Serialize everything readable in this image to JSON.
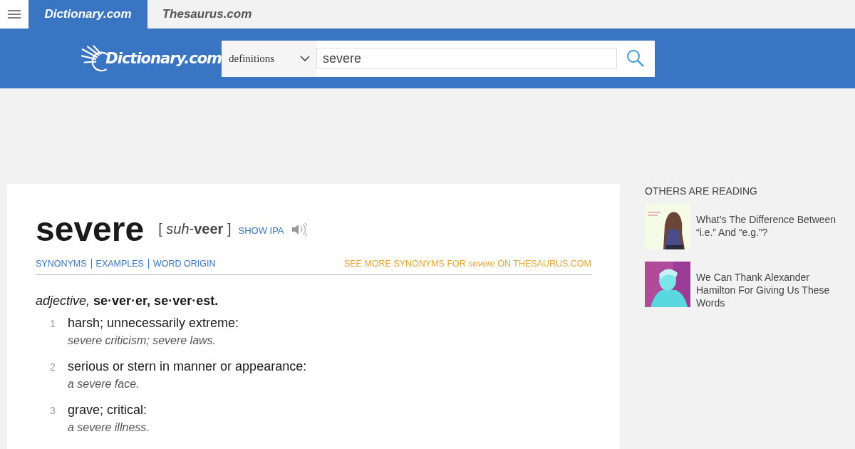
{
  "site_tabs": [
    {
      "label": "Dictionary.com",
      "selected": true
    },
    {
      "label": "Thesaurus.com",
      "selected": false
    }
  ],
  "header": {
    "logo": "Dictionary.com",
    "search_type": "definitions",
    "search_value": "severe"
  },
  "entry": {
    "word": "severe",
    "pronunciation": "[ *suh*-**veer** ]",
    "show_ipa": "SHOW IPA",
    "links": [
      "SYNONYMS",
      "EXAMPLES",
      "WORD ORIGIN"
    ],
    "thesaurus_link": "SEE MORE SYNONYMS FOR *severe* ON THESAURUS.COM",
    "inflection": "*adjective,* **se·ver·er, se·ver·est.**",
    "definitions": [
      {
        "number": "1",
        "text": "harsh; unnecessarily extreme:",
        "example": "severe criticism; severe laws."
      },
      {
        "number": "2",
        "text": "serious or stern in manner or appearance:",
        "example": "a severe face."
      },
      {
        "number": "3",
        "text": "grave; critical:",
        "example": "a severe illness."
      }
    ]
  },
  "sidebar": {
    "title": "OTHERS ARE READING",
    "articles": [
      {
        "title": "What’s The Difference Between “i.e.” And “e.g.”?",
        "kind": "picture"
      },
      {
        "title": "We Can Thank Alexander Hamilton For Giving Us These Words",
        "kind": "picture"
      }
    ]
  }
}
